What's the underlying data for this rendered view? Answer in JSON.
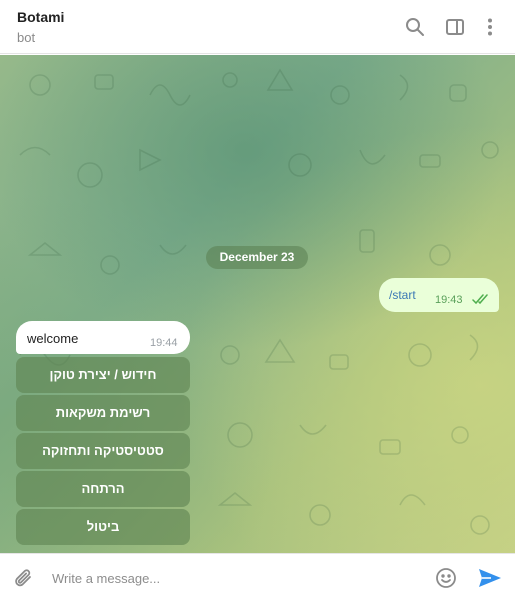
{
  "header": {
    "title": "Botami",
    "status": "bot",
    "icons": [
      "search-icon",
      "sidebar-toggle-icon",
      "more-vertical-icon"
    ]
  },
  "chat": {
    "date_separator": "December 23",
    "messages": [
      {
        "direction": "outgoing",
        "text": "/start",
        "time": "19:43",
        "read": true
      },
      {
        "direction": "incoming",
        "text": "welcome",
        "time": "19:44"
      }
    ],
    "keyboard_buttons": [
      "חידוש / יצירת טוקן",
      "רשימת משקאות",
      "סטטיסטיקה ותחזוקה",
      "הרתחה",
      "ביטול"
    ]
  },
  "composer": {
    "placeholder": "Write a message...",
    "icons": [
      "paperclip-icon",
      "emoji-icon",
      "send-icon"
    ]
  },
  "colors": {
    "outgoing_bubble": "#eaffd9",
    "incoming_bubble": "#ffffff",
    "send_accent": "#3390ec",
    "keyboard_button": "#608552"
  }
}
